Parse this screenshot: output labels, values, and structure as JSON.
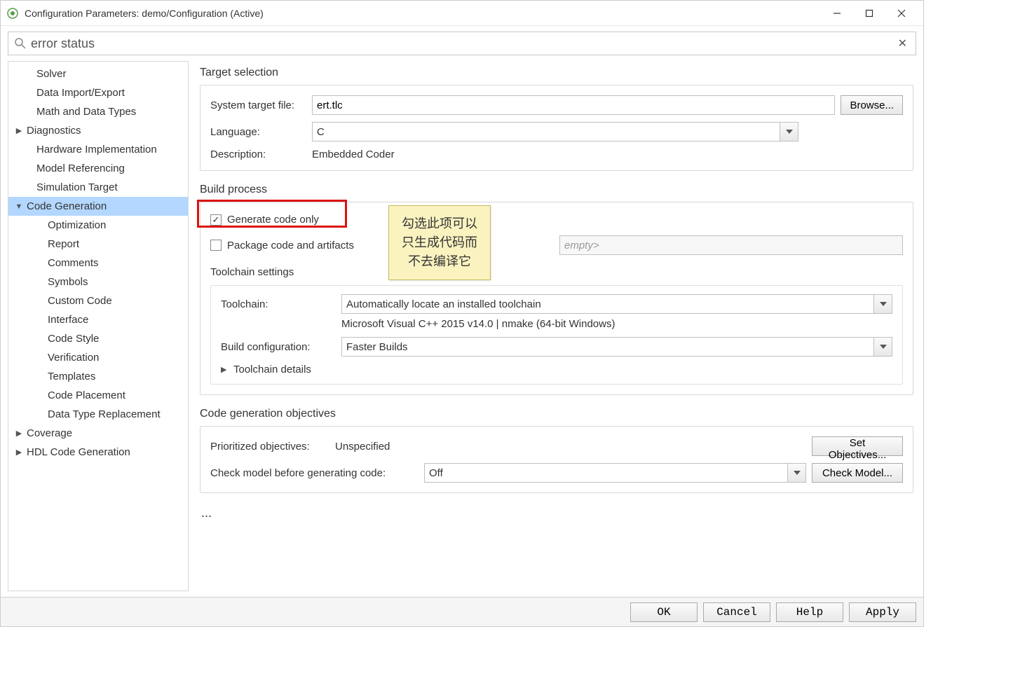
{
  "window": {
    "title": "Configuration Parameters: demo/Configuration (Active)"
  },
  "search": {
    "value": "error status",
    "clear_glyph": "✕"
  },
  "nav": [
    {
      "label": "Solver",
      "depth": 1,
      "arrow": ""
    },
    {
      "label": "Data Import/Export",
      "depth": 1,
      "arrow": ""
    },
    {
      "label": "Math and Data Types",
      "depth": 1,
      "arrow": ""
    },
    {
      "label": "Diagnostics",
      "depth": 1,
      "arrow": "▶"
    },
    {
      "label": "Hardware Implementation",
      "depth": 1,
      "arrow": ""
    },
    {
      "label": "Model Referencing",
      "depth": 1,
      "arrow": ""
    },
    {
      "label": "Simulation Target",
      "depth": 1,
      "arrow": ""
    },
    {
      "label": "Code Generation",
      "depth": 1,
      "arrow": "▼",
      "selected": true
    },
    {
      "label": "Optimization",
      "depth": 2,
      "arrow": ""
    },
    {
      "label": "Report",
      "depth": 2,
      "arrow": ""
    },
    {
      "label": "Comments",
      "depth": 2,
      "arrow": ""
    },
    {
      "label": "Symbols",
      "depth": 2,
      "arrow": ""
    },
    {
      "label": "Custom Code",
      "depth": 2,
      "arrow": ""
    },
    {
      "label": "Interface",
      "depth": 2,
      "arrow": ""
    },
    {
      "label": "Code Style",
      "depth": 2,
      "arrow": ""
    },
    {
      "label": "Verification",
      "depth": 2,
      "arrow": ""
    },
    {
      "label": "Templates",
      "depth": 2,
      "arrow": ""
    },
    {
      "label": "Code Placement",
      "depth": 2,
      "arrow": ""
    },
    {
      "label": "Data Type Replacement",
      "depth": 2,
      "arrow": ""
    },
    {
      "label": "Coverage",
      "depth": 1,
      "arrow": "▶"
    },
    {
      "label": "HDL Code Generation",
      "depth": 1,
      "arrow": "▶"
    }
  ],
  "target_selection": {
    "title": "Target selection",
    "system_target_file_label": "System target file:",
    "system_target_file_value": "ert.tlc",
    "browse_label": "Browse...",
    "language_label": "Language:",
    "language_value": "C",
    "description_label": "Description:",
    "description_value": "Embedded Coder"
  },
  "build_process": {
    "title": "Build process",
    "generate_code_only_label": "Generate code only",
    "package_code_label": "Package code and artifacts",
    "zip_placeholder": "empty>",
    "toolchain_settings_title": "Toolchain settings",
    "toolchain_label": "Toolchain:",
    "toolchain_value": "Automatically locate an installed toolchain",
    "toolchain_desc": "Microsoft Visual C++ 2015 v14.0 | nmake (64-bit Windows)",
    "build_config_label": "Build configuration:",
    "build_config_value": "Faster Builds",
    "toolchain_details_label": "Toolchain details"
  },
  "objectives": {
    "title": "Code generation objectives",
    "prioritized_label": "Prioritized objectives:",
    "prioritized_value": "Unspecified",
    "set_objectives_label": "Set Objectives...",
    "check_model_label": "Check model before generating code:",
    "check_model_value": "Off",
    "check_model_button": "Check Model..."
  },
  "ellipsis": "...",
  "tooltip": {
    "line1": "勾选此项可以",
    "line2": "只生成代码而",
    "line3": "不去编译它"
  },
  "buttons": {
    "ok": "OK",
    "cancel": "Cancel",
    "help": "Help",
    "apply": "Apply"
  }
}
